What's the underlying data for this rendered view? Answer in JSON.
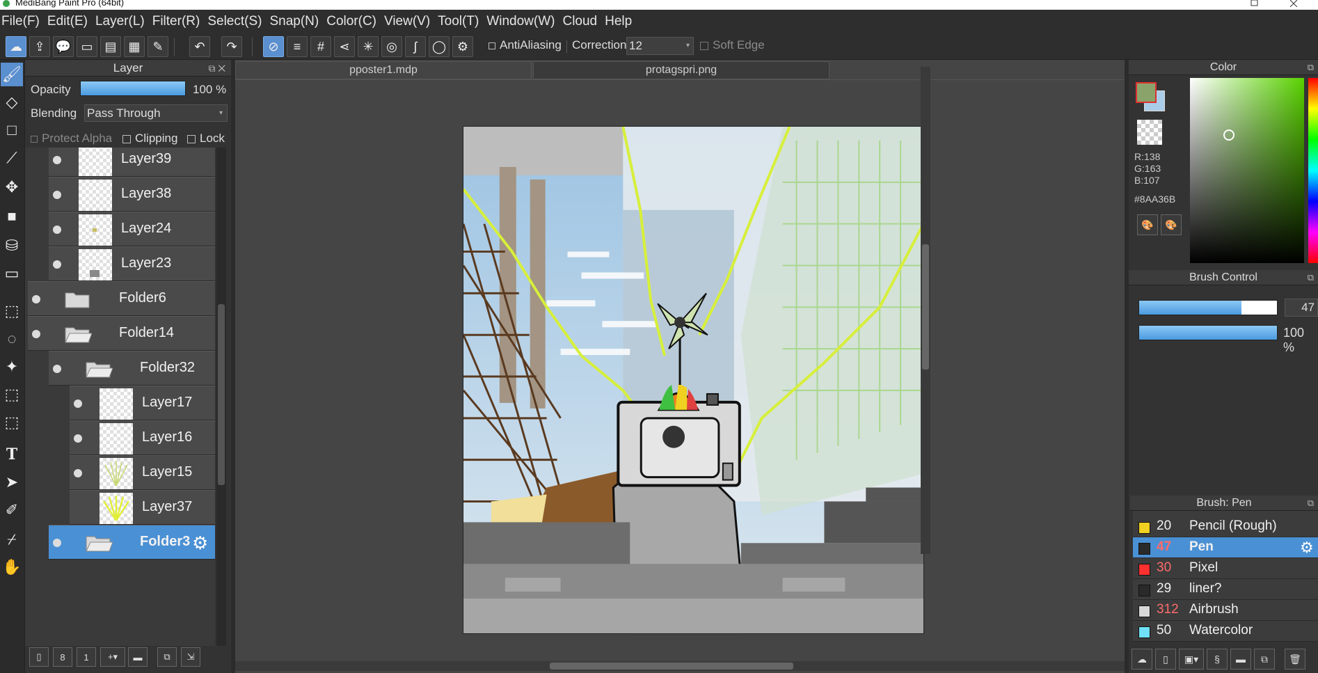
{
  "window": {
    "title": "MediBang Paint Pro (64bit)"
  },
  "menu": [
    "File(F)",
    "Edit(E)",
    "Layer(L)",
    "Filter(R)",
    "Select(S)",
    "Snap(N)",
    "Color(C)",
    "View(V)",
    "Tool(T)",
    "Window(W)",
    "Cloud",
    "Help"
  ],
  "toolbar": {
    "antialiasing": "AntiAliasing",
    "correction_label": "Correction",
    "correction_value": "12",
    "soft_edge": "Soft Edge"
  },
  "layer_panel": {
    "title": "Layer",
    "opacity_label": "Opacity",
    "opacity_value": "100 %",
    "blending_label": "Blending",
    "blending_value": "Pass Through",
    "protect_alpha": "Protect Alpha",
    "clipping": "Clipping",
    "lock": "Lock",
    "layers": [
      {
        "name": "Layer39",
        "kind": "layer",
        "visible": true
      },
      {
        "name": "Layer38",
        "kind": "layer",
        "visible": true
      },
      {
        "name": "Layer24",
        "kind": "layer",
        "visible": true
      },
      {
        "name": "Layer23",
        "kind": "layer",
        "visible": true
      },
      {
        "name": "Folder6",
        "kind": "folder",
        "visible": true
      },
      {
        "name": "Folder14",
        "kind": "folder",
        "visible": true
      },
      {
        "name": "Folder32",
        "kind": "folder",
        "visible": true
      },
      {
        "name": "Layer17",
        "kind": "layer",
        "visible": true
      },
      {
        "name": "Layer16",
        "kind": "layer",
        "visible": true
      },
      {
        "name": "Layer15",
        "kind": "layer",
        "visible": true
      },
      {
        "name": "Layer37",
        "kind": "layer",
        "visible": false
      },
      {
        "name": "Folder3",
        "kind": "folder",
        "visible": true,
        "selected": true
      }
    ]
  },
  "document_tabs": [
    {
      "label": "pposter1.mdp",
      "active": true
    },
    {
      "label": "protagspri.png",
      "active": false
    }
  ],
  "color_panel": {
    "title": "Color",
    "r": "R:138",
    "g": "G:163",
    "b": "B:107",
    "hex": "#8AA36B",
    "fg_color": "#8AA36B"
  },
  "brush_control": {
    "title": "Brush Control",
    "size_value": "47",
    "opacity_value": "100 %"
  },
  "brush_panel": {
    "title": "Brush: Pen",
    "brushes": [
      {
        "size": "20",
        "name": "Pencil (Rough)",
        "color": "#f0d020",
        "size_color": "#f0f0f0"
      },
      {
        "size": "47",
        "name": "Pen",
        "color": "#2a2a2a",
        "size_color": "#ff6b6b",
        "selected": true
      },
      {
        "size": "30",
        "name": "Pixel",
        "color": "#ff3030",
        "size_color": "#ff6b6b"
      },
      {
        "size": "29",
        "name": "liner?",
        "color": "#2a2a2a",
        "size_color": "#f0f0f0"
      },
      {
        "size": "312",
        "name": "Airbrush",
        "color": "#d8d8d8",
        "size_color": "#ff6b6b"
      },
      {
        "size": "50",
        "name": "Watercolor",
        "color": "#6fe0f5",
        "size_color": "#f0f0f0"
      }
    ]
  }
}
